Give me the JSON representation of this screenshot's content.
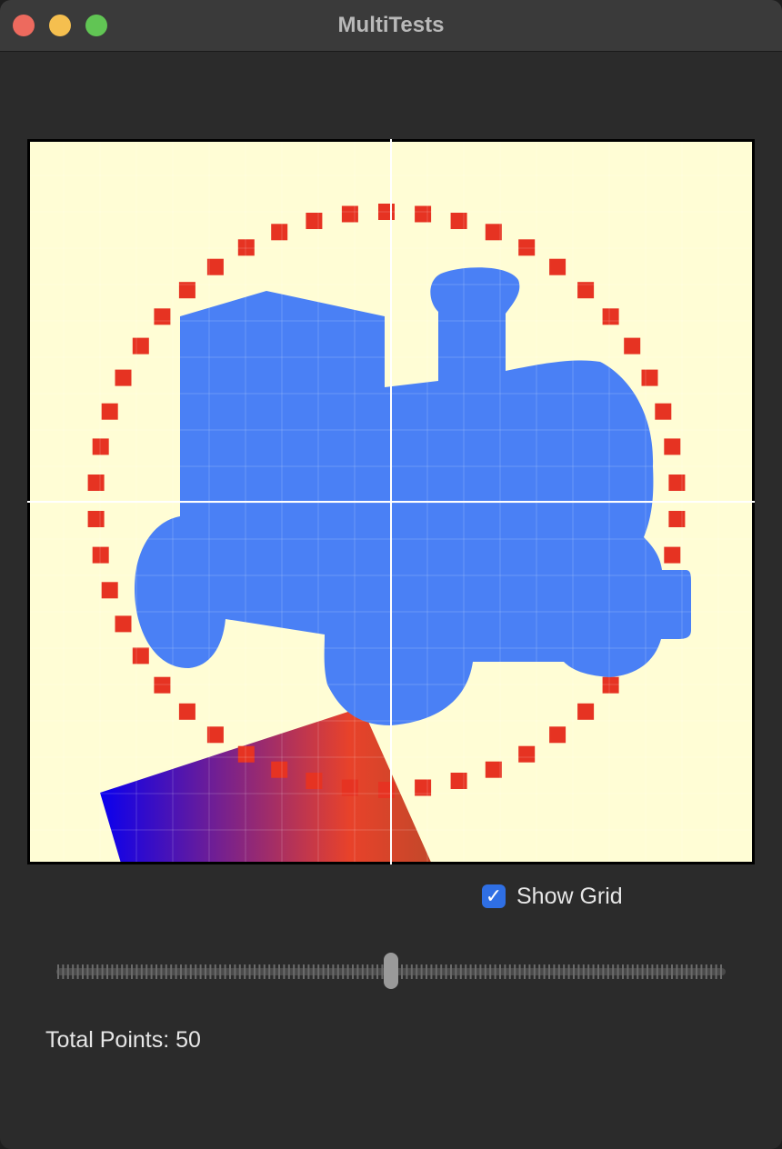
{
  "window": {
    "title": "MultiTests"
  },
  "canvas": {
    "background_color": "#fffdd5",
    "train_color": "#4a80f5",
    "dot_color": "#e63322",
    "gradient_colors": [
      "#0a00ee",
      "#e8422a",
      "#c2482a"
    ]
  },
  "controls": {
    "show_grid_label": "Show Grid",
    "show_grid_checked": true,
    "slider_value": 0.5,
    "total_points_label": "Total Points:",
    "total_points_value": "50"
  }
}
